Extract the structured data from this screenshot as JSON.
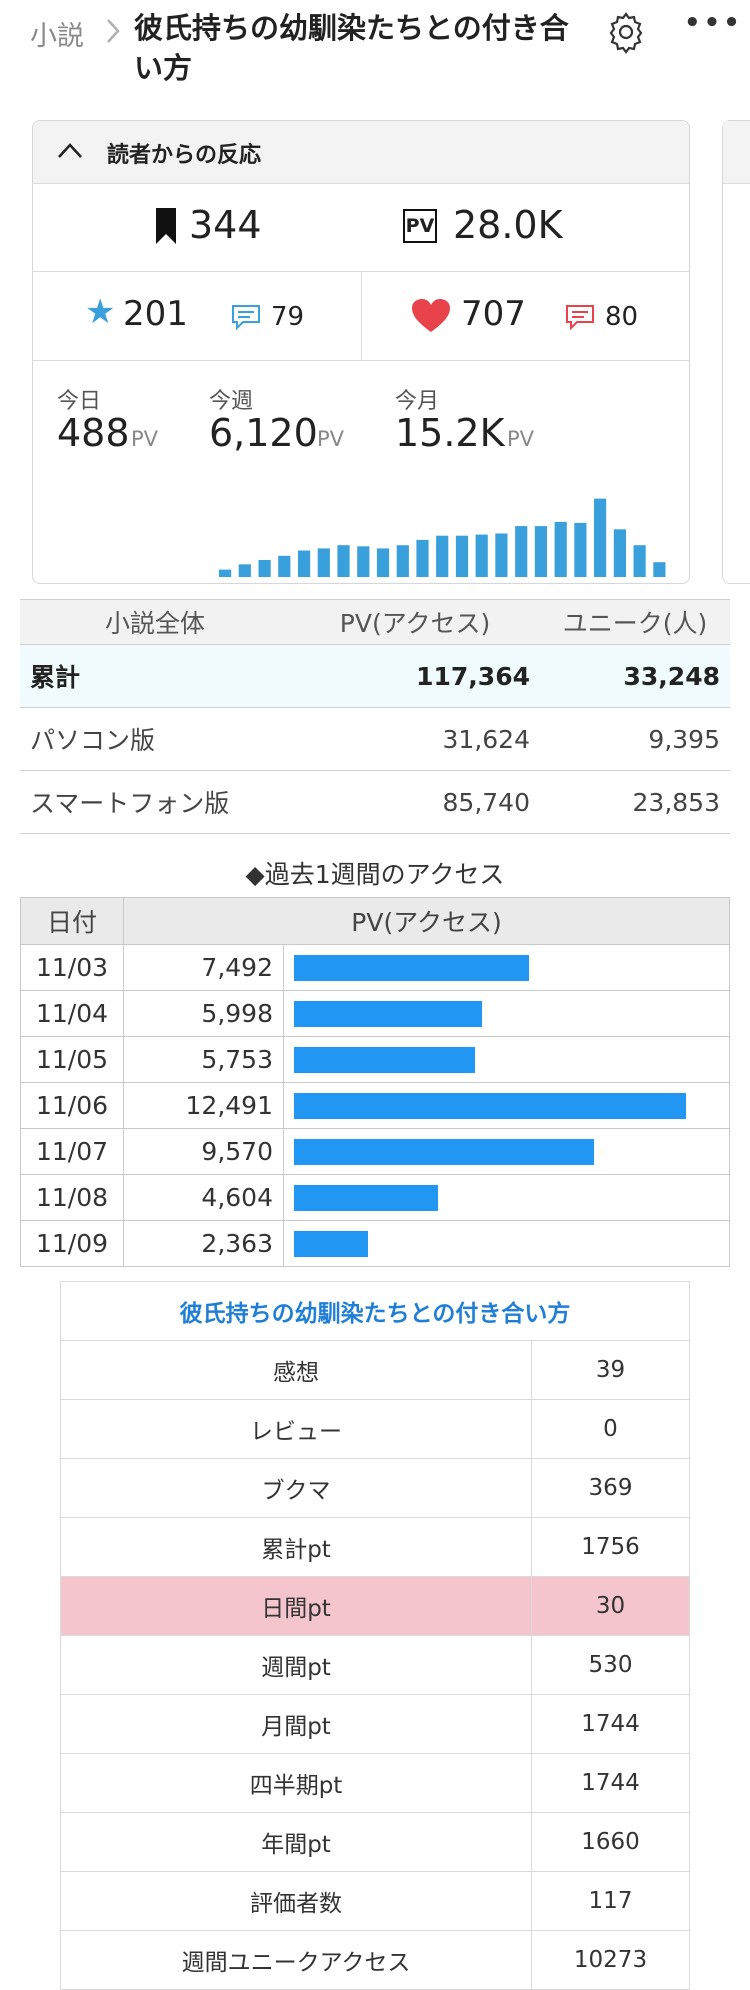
{
  "header": {
    "breadcrumb": "小説",
    "title": "彼氏持ちの幼馴染たちとの付き合い方"
  },
  "reactions": {
    "section_label": "読者からの反応",
    "bookmarks": "344",
    "pv_badge": "PV",
    "pv_total": "28.0K",
    "stars": "201",
    "star_comments": "79",
    "hearts": "707",
    "heart_comments": "80",
    "today_label": "今日",
    "today_value": "488",
    "week_label": "今週",
    "week_value": "6,120",
    "month_label": "今月",
    "month_value": "15.2K",
    "unit": "PV",
    "mini_chart": [
      0.07,
      0.12,
      0.16,
      0.2,
      0.25,
      0.27,
      0.3,
      0.29,
      0.27,
      0.3,
      0.35,
      0.39,
      0.39,
      0.4,
      0.41,
      0.48,
      0.48,
      0.52,
      0.51,
      0.74,
      0.45,
      0.3,
      0.14
    ],
    "accent_blue": "#3aa0dc",
    "accent_red": "#e8434b"
  },
  "novel_table": {
    "headers": [
      "小説全体",
      "PV(アクセス)",
      "ユニーク(人)"
    ],
    "rows": [
      {
        "label": "累計",
        "pv": "117,364",
        "unique": "33,248"
      },
      {
        "label": "パソコン版",
        "pv": "31,624",
        "unique": "9,395"
      },
      {
        "label": "スマートフォン版",
        "pv": "85,740",
        "unique": "23,853"
      }
    ]
  },
  "weekly": {
    "title": "◆過去1週間のアクセス",
    "headers": [
      "日付",
      "PV(アクセス)"
    ],
    "max": 12491,
    "rows": [
      {
        "date": "11/03",
        "pv": "7,492",
        "value": 7492
      },
      {
        "date": "11/04",
        "pv": "5,998",
        "value": 5998
      },
      {
        "date": "11/05",
        "pv": "5,753",
        "value": 5753
      },
      {
        "date": "11/06",
        "pv": "12,491",
        "value": 12491
      },
      {
        "date": "11/07",
        "pv": "9,570",
        "value": 9570
      },
      {
        "date": "11/08",
        "pv": "4,604",
        "value": 4604
      },
      {
        "date": "11/09",
        "pv": "2,363",
        "value": 2363
      }
    ]
  },
  "ranking": {
    "title": "彼氏持ちの幼馴染たちとの付き合い方",
    "rows": [
      {
        "label": "感想",
        "value": "39"
      },
      {
        "label": "レビュー",
        "value": "0"
      },
      {
        "label": "ブクマ",
        "value": "369"
      },
      {
        "label": "累計pt",
        "value": "1756"
      },
      {
        "label": "日間pt",
        "value": "30"
      },
      {
        "label": "週間pt",
        "value": "530"
      },
      {
        "label": "月間pt",
        "value": "1744"
      },
      {
        "label": "四半期pt",
        "value": "1744"
      },
      {
        "label": "年間pt",
        "value": "1660"
      },
      {
        "label": "評価者数",
        "value": "117"
      },
      {
        "label": "週間ユニークアクセス",
        "value": "10273"
      }
    ]
  }
}
